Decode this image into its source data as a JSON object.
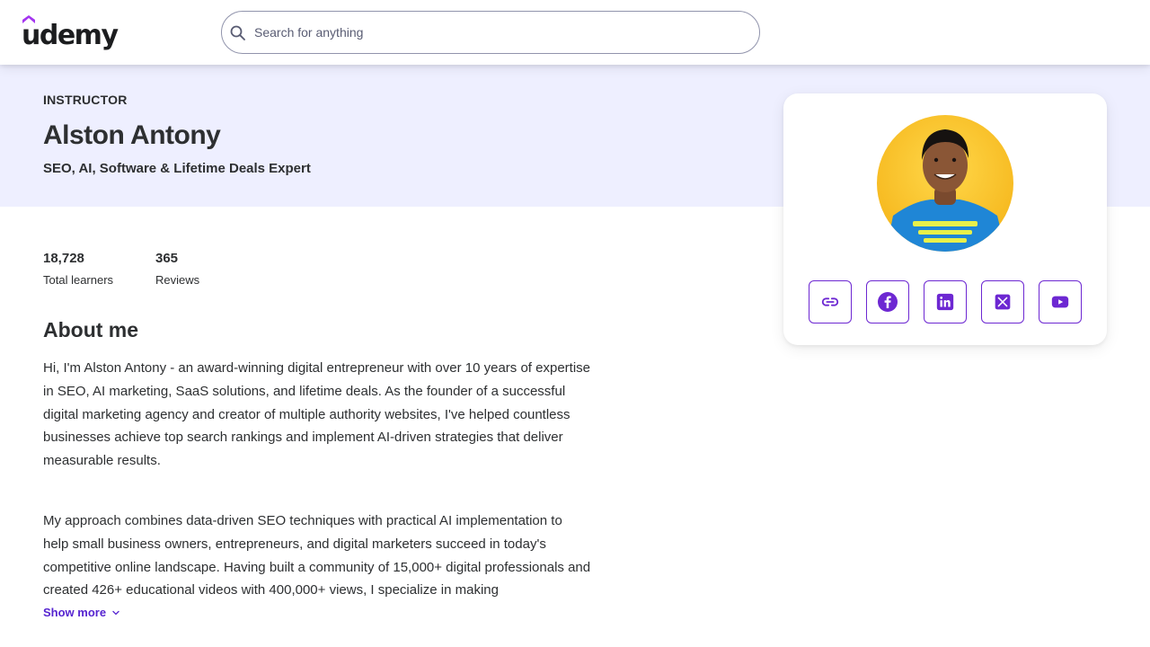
{
  "header": {
    "logo_text": "udemy",
    "search_placeholder": "Search for anything"
  },
  "banner": {
    "eyebrow": "INSTRUCTOR",
    "name": "Alston Antony",
    "headline": "SEO, AI, Software & Lifetime Deals Expert"
  },
  "stats": [
    {
      "value": "18,728",
      "label": "Total learners"
    },
    {
      "value": "365",
      "label": "Reviews"
    }
  ],
  "about": {
    "title": "About me",
    "paragraphs": [
      "Hi, I'm Alston Antony - an award-winning digital entrepreneur with over 10 years of expertise in SEO, AI marketing, SaaS solutions, and lifetime deals. As the founder of a successful digital marketing agency and creator of multiple authority websites, I've helped countless businesses achieve top search rankings and implement AI-driven strategies that deliver measurable results.",
      "My approach combines data-driven SEO techniques with practical AI implementation to help small business owners, entrepreneurs, and digital marketers succeed in today's competitive online landscape. Having built a community of 15,000+ digital professionals and created 426+ educational videos with 400,000+ views, I specialize in making"
    ],
    "show_more_label": "Show more"
  },
  "card": {
    "social_links": [
      {
        "icon": "link-icon"
      },
      {
        "icon": "facebook-icon"
      },
      {
        "icon": "linkedin-icon"
      },
      {
        "icon": "x-twitter-icon"
      },
      {
        "icon": "youtube-icon"
      }
    ]
  },
  "colors": {
    "brand_purple": "#6d28d2",
    "link_purple": "#5624d0",
    "banner_bg": "#eeefff",
    "text": "#2d2f31"
  }
}
